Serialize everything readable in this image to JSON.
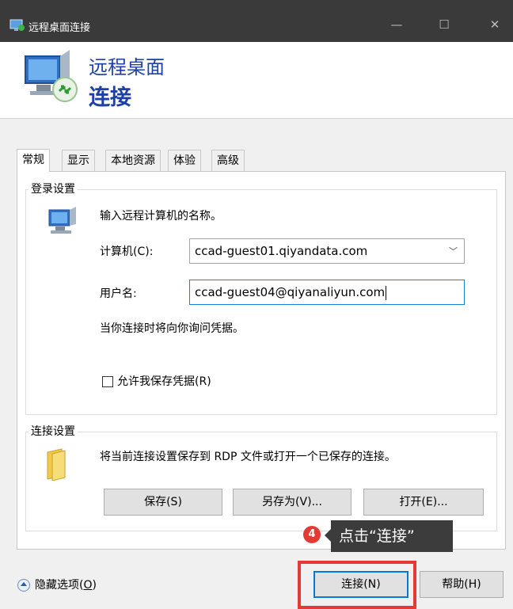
{
  "window": {
    "title": "远程桌面连接",
    "minimize": "—",
    "maximize": "☐",
    "close": "✕"
  },
  "banner": {
    "line1": "远程桌面",
    "line2": "连接"
  },
  "tabs": [
    {
      "label": "常规",
      "active": true
    },
    {
      "label": "显示"
    },
    {
      "label": "本地资源"
    },
    {
      "label": "体验"
    },
    {
      "label": "高级"
    }
  ],
  "login": {
    "group_label": "登录设置",
    "intro": "输入远程计算机的名称。",
    "computer_label": "计算机(C):",
    "computer_value": "ccad-guest01.qiyandata.com",
    "user_label": "用户名:",
    "user_value": "ccad-guest04@qiyanaliyun.com",
    "cred_note": "当你连接时将向你询问凭据。",
    "save_cred_label": "允许我保存凭据(R)"
  },
  "conn": {
    "group_label": "连接设置",
    "desc": "将当前连接设置保存到 RDP 文件或打开一个已保存的连接。",
    "save": "保存(S)",
    "save_as": "另存为(V)...",
    "open": "打开(E)..."
  },
  "footer": {
    "hide_options": "隐藏选项(",
    "hide_options_key": "O",
    "hide_options_end": ")",
    "connect": "连接(N)",
    "help": "帮助(H)"
  },
  "annotation": {
    "step": "4",
    "text": "点击“连接”",
    "accent": "#e53935"
  }
}
